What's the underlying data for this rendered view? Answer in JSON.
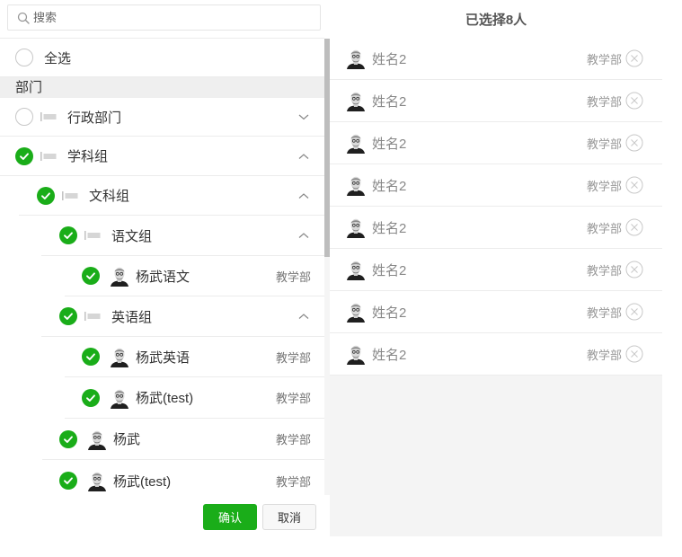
{
  "search": {
    "placeholder": "搜索"
  },
  "select_all_label": "全选",
  "section_title": "部门",
  "tree": {
    "admin_dept": {
      "label": "行政部门",
      "checked": false,
      "expanded": false
    },
    "subject_group": {
      "label": "学科组",
      "checked": true,
      "expanded": true
    },
    "arts_group": {
      "label": "文科组",
      "checked": true,
      "expanded": true
    },
    "chinese_group": {
      "label": "语文组",
      "checked": true,
      "expanded": true
    },
    "english_group": {
      "label": "英语组",
      "checked": true,
      "expanded": true
    },
    "users": [
      {
        "name": "杨武语文",
        "dept": "教学部",
        "checked": true
      },
      {
        "name": "杨武英语",
        "dept": "教学部",
        "checked": true
      },
      {
        "name": "杨武(test)",
        "dept": "教学部",
        "checked": true
      },
      {
        "name": "杨武",
        "dept": "教学部",
        "checked": true
      },
      {
        "name": "杨武(test)",
        "dept": "教学部",
        "checked": true
      }
    ]
  },
  "buttons": {
    "confirm": "确认",
    "cancel": "取消"
  },
  "selected": {
    "title": "已选择8人",
    "items": [
      {
        "name": "姓名2",
        "dept": "教学部"
      },
      {
        "name": "姓名2",
        "dept": "教学部"
      },
      {
        "name": "姓名2",
        "dept": "教学部"
      },
      {
        "name": "姓名2",
        "dept": "教学部"
      },
      {
        "name": "姓名2",
        "dept": "教学部"
      },
      {
        "name": "姓名2",
        "dept": "教学部"
      },
      {
        "name": "姓名2",
        "dept": "教学部"
      },
      {
        "name": "姓名2",
        "dept": "教学部"
      }
    ]
  },
  "colors": {
    "accent": "#1aad19",
    "divider": "#ececec",
    "panel_bg": "#f4f4f4"
  },
  "icons": {
    "search": "search-icon",
    "check": "check-circle-icon",
    "folder": "flag-icon",
    "avatar": "avatar-icon",
    "expand": "chevron-down-icon",
    "collapse": "chevron-up-icon",
    "remove": "close-circle-icon"
  }
}
